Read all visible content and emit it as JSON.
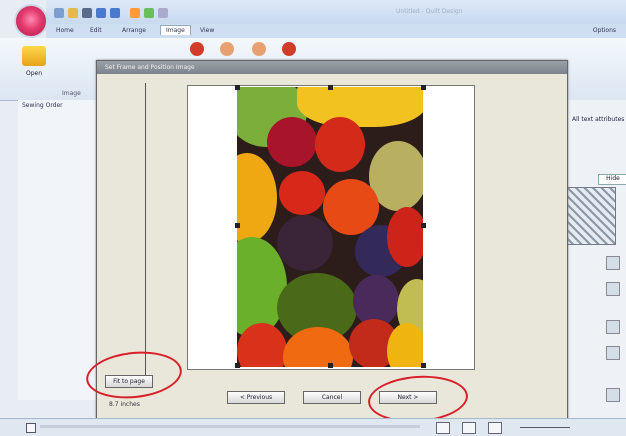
{
  "window": {
    "title": "Untitled - Quilt Design"
  },
  "tabs": [
    {
      "label": "Home"
    },
    {
      "label": "Edit"
    },
    {
      "label": "Arrange"
    },
    {
      "label": "Image"
    },
    {
      "label": "View"
    }
  ],
  "options_label": "Options",
  "ribbon": {
    "open_label": "Open",
    "image_group_label": "Image"
  },
  "left_panel": {
    "title": "Sewing Order"
  },
  "right_panel": {
    "attr_label": "All text attributes",
    "hide_label": "Hide"
  },
  "dialog": {
    "title": "Set Frame and Position Image",
    "status_text": "8.7 inches",
    "buttons": {
      "fit_to_page": "Fit to page",
      "previous": "< Previous",
      "cancel": "Cancel",
      "next": "Next >"
    }
  },
  "colors": {
    "highlight": "#d8202b",
    "accent": "#e23a6e"
  }
}
